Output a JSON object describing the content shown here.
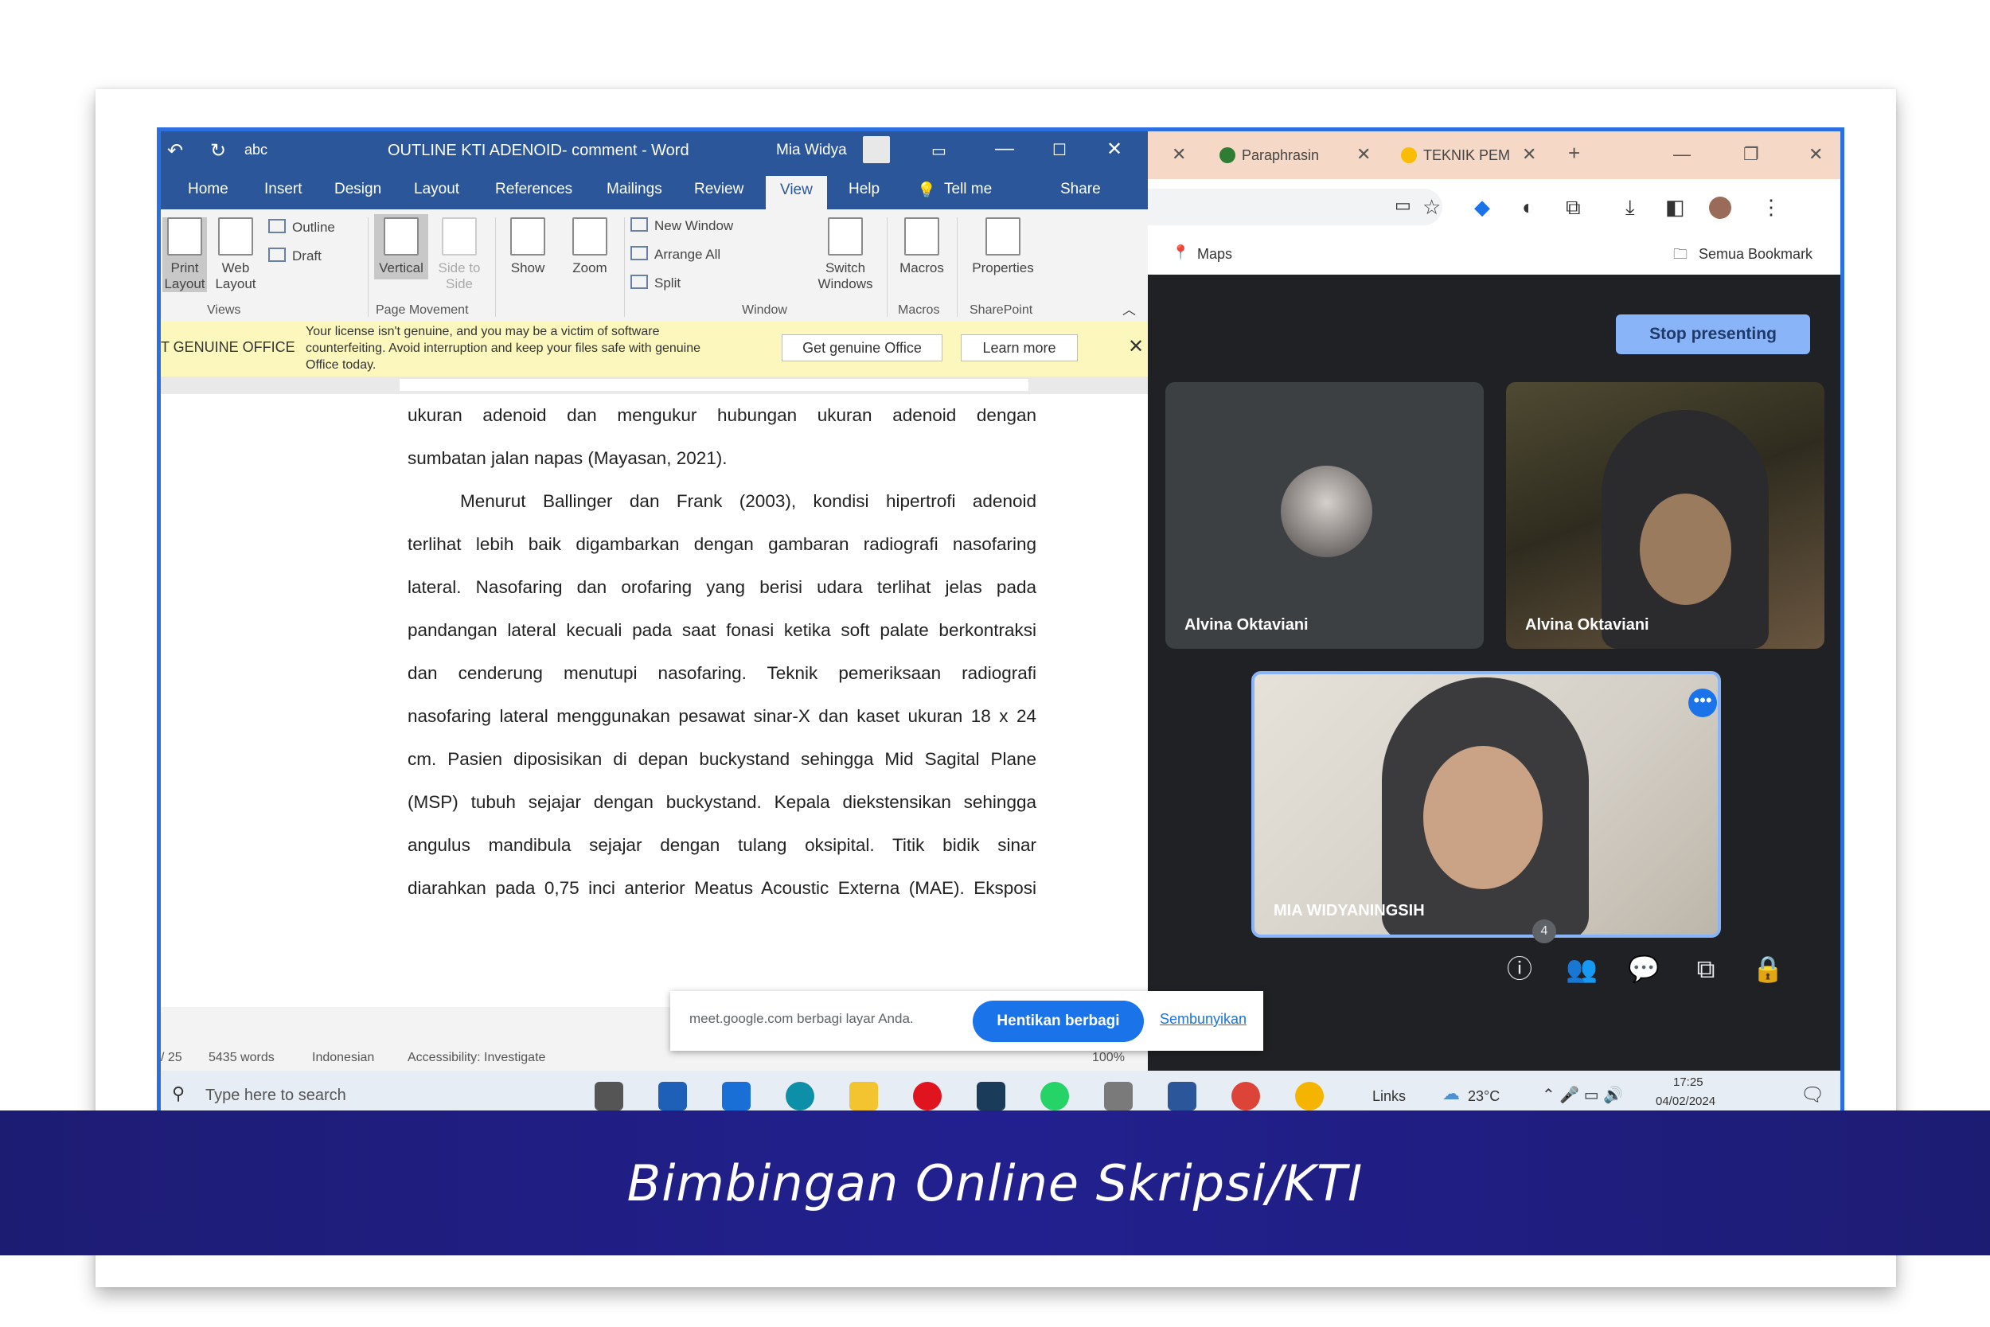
{
  "word": {
    "window_title": "OUTLINE KTI ADENOID- comment - Word",
    "user": "Mia Widya",
    "tabs": [
      "Home",
      "Insert",
      "Design",
      "Layout",
      "References",
      "Mailings",
      "Review",
      "View",
      "Help",
      "Tell me",
      "Share"
    ],
    "ribbon": {
      "print_layout": "Print Layout",
      "web_layout": "Web Layout",
      "outline": "Outline",
      "draft": "Draft",
      "vertical": "Vertical",
      "side_to_side": "Side to Side",
      "show": "Show",
      "zoom": "Zoom",
      "new_window": "New Window",
      "arrange_all": "Arrange All",
      "split": "Split",
      "switch_windows": "Switch Windows",
      "macros": "Macros",
      "properties": "Properties",
      "groups": [
        "Views",
        "Page Movement",
        "Window",
        "Macros",
        "SharePoint"
      ]
    },
    "notice": {
      "label": "T GENUINE OFFICE",
      "message": "Your license isn't genuine, and you may be a victim of software counterfeiting. Avoid interruption and keep your files safe with genuine Office today.",
      "get_genuine": "Get genuine Office",
      "learn_more": "Learn more"
    },
    "document_lines": [
      "ukuran adenoid dan mengukur hubungan ukuran adenoid dengan",
      "sumbatan jalan napas (Mayasan, 2021).",
      "Menurut Ballinger dan Frank (2003), kondisi hipertrofi adenoid",
      "terlihat lebih baik digambarkan dengan gambaran radiografi nasofaring",
      "lateral. Nasofaring dan orofaring yang berisi udara terlihat jelas pada",
      "pandangan lateral kecuali pada saat fonasi ketika soft palate berkontraksi",
      "dan cenderung menutupi nasofaring. Teknik pemeriksaan radiografi",
      "nasofaring lateral menggunakan pesawat sinar-X dan kaset ukuran 18 x 24",
      "cm. Pasien diposisikan di depan buckystand sehingga Mid Sagital Plane",
      "(MSP) tubuh sejajar dengan buckystand. Kepala diekstensikan sehingga",
      "angulus mandibula sejajar dengan tulang oksipital. Titik bidik sinar",
      "diarahkan pada 0,75 inci anterior Meatus Acoustic Externa (MAE). Eksposi"
    ],
    "status": {
      "page": "/ 25",
      "words": "5435 words",
      "language": "Indonesian",
      "accessibility": "Accessibility: Investigate",
      "zoom": "100%"
    }
  },
  "share_popup": {
    "text": "meet.google.com berbagi layar Anda.",
    "stop_button": "Hentikan berbagi",
    "hide_link": "Sembunyikan"
  },
  "chrome": {
    "tabs": [
      "Paraphrasin",
      "TEKNIK PEM"
    ],
    "bookmarks": [
      "Maps",
      "Semua Bookmark"
    ]
  },
  "meet": {
    "stop_presenting": "Stop presenting",
    "participants": [
      "Alvina Oktaviani",
      "Alvina Oktaviani",
      "MIA WIDYANINGSIH"
    ],
    "participant_count": "4"
  },
  "taskbar": {
    "search_placeholder": "Type here to search",
    "links": "Links",
    "weather": "23°C",
    "time": "17:25",
    "date": "04/02/2024"
  },
  "caption": "Bimbingan Online Skripsi/KTI"
}
